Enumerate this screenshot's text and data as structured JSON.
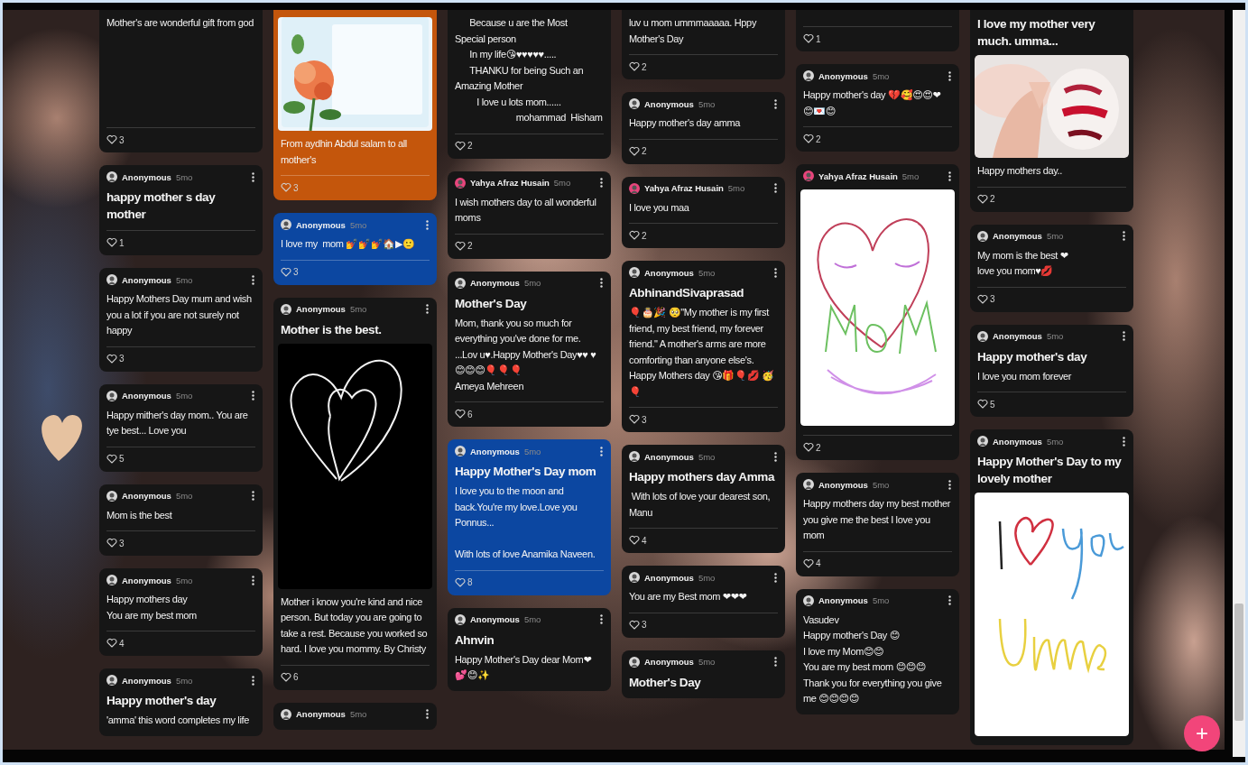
{
  "columns": [
    {
      "cards": [
        {
          "color": "#161616",
          "body": "Mother's are wonderful gift from god",
          "likes": "3"
        },
        {
          "color": "#161616",
          "author": "Anonymous",
          "time": "5mo",
          "avatar": {
            "color": "#d8d8d8"
          },
          "title": "happy mother s day mother",
          "likes": "1"
        },
        {
          "color": "#161616",
          "author": "Anonymous",
          "time": "5mo",
          "avatar": {
            "color": "#d8d8d8"
          },
          "body": "Happy Mothers Day mum and wish you a lot if you are not surely not happy",
          "likes": "3"
        },
        {
          "color": "#161616",
          "author": "Anonymous",
          "time": "5mo",
          "avatar": {
            "color": "#d8d8d8"
          },
          "body": "Happy mither's day mom.. You are tye best... Love you",
          "likes": "5"
        },
        {
          "color": "#161616",
          "author": "Anonymous",
          "time": "5mo",
          "avatar": {
            "color": "#d8d8d8"
          },
          "body": "Mom is the best",
          "likes": "3"
        },
        {
          "color": "#161616",
          "author": "Anonymous",
          "time": "5mo",
          "avatar": {
            "color": "#d8d8d8"
          },
          "body": "Happy mothers day\nYou are my best mom",
          "likes": "4"
        },
        {
          "color": "#161616",
          "author": "Anonymous",
          "time": "5mo",
          "avatar": {
            "color": "#d8d8d8"
          },
          "title": "Happy mother's day",
          "body": "'amma' this word completes my life"
        }
      ]
    },
    {
      "cards": [
        {
          "color": "#c4560c",
          "body": "From aydhin Abdul salam to all mother's",
          "likes": "3"
        },
        {
          "color": "#0c47a1",
          "author": "Anonymous",
          "time": "5mo",
          "avatar": {
            "color": "#d8d8d8"
          },
          "body": "I love my  mom 💅💅💅🏠▶🙂",
          "likes": "3"
        },
        {
          "color": "#161616",
          "author": "Anonymous",
          "time": "5mo",
          "avatar": {
            "color": "#d8d8d8"
          },
          "title": "Mother is the best.",
          "media": {
            "kind": "heart-sketch"
          },
          "body": "Mother i know you're kind and nice person. But today you are going to take a rest. Because you worked so hard. I love you mommy. By Christy",
          "likes": "6"
        },
        {
          "color": "#161616",
          "author": "Anonymous",
          "time": "5mo",
          "avatar": {
            "color": "#d8d8d8"
          }
        }
      ]
    },
    {
      "cards": [
        {
          "color": "#161616",
          "body": "      Because u are the Most\nSpecial person\n      In my life😘♥♥♥♥♥.....\n      THANKU for being Such an\nAmazing Mother\n         I love u lots mom......\n                         mohammad  Hisham",
          "likes": "2"
        },
        {
          "color": "#161616",
          "author": "Yahya Afraz Husain",
          "time": "5mo",
          "avatar": {
            "color": "#e8457c"
          },
          "body": "I wish mothers day to all wonderful moms",
          "likes": "2"
        },
        {
          "color": "#161616",
          "author": "Anonymous",
          "time": "5mo",
          "avatar": {
            "color": "#d8d8d8"
          },
          "title": "Mother's Day",
          "body": "Mom, thank you so much for everything you've done for me. ...Lov u♥.Happy Mother's Day♥♥ ♥😊😊😊🎈🎈🎈\nAmeya Mehreen",
          "likes": "6"
        },
        {
          "color": "#0c47a1",
          "author": "Anonymous",
          "time": "5mo",
          "avatar": {
            "color": "#d8d8d8"
          },
          "title": "Happy Mother's Day mom",
          "body": "I love you to the moon and back.You're my love.Love you Ponnus...\n\nWith lots of love Anamika Naveen.",
          "likes": "8"
        },
        {
          "color": "#161616",
          "author": "Anonymous",
          "time": "5mo",
          "avatar": {
            "color": "#d8d8d8"
          },
          "title": "Ahnvin",
          "body": "Happy Mother's Day dear Mom❤ 💕😊✨"
        }
      ]
    },
    {
      "cards": [
        {
          "color": "#161616",
          "body": "luv u mom ummmaaaaa. Hppy Mother's Day",
          "likes": "2"
        },
        {
          "color": "#161616",
          "author": "Anonymous",
          "time": "5mo",
          "avatar": {
            "color": "#d8d8d8"
          },
          "body": "Happy mother's day amma",
          "likes": "2"
        },
        {
          "color": "#161616",
          "author": "Yahya Afraz Husain",
          "time": "5mo",
          "avatar": {
            "color": "#e8457c"
          },
          "body": "I love you maa",
          "likes": "2"
        },
        {
          "color": "#161616",
          "author": "Anonymous",
          "time": "5mo",
          "avatar": {
            "color": "#d8d8d8"
          },
          "title": "AbhinandSivaprasad",
          "body": "🎈🎂🎉 🥺\"My mother is my first friend, my best friend, my forever friend.\" A mother's arms are more comforting than anyone else's. Happy Mothers day 😘🎁🎈💋 🥳🎈",
          "likes": "3"
        },
        {
          "color": "#161616",
          "author": "Anonymous",
          "time": "5mo",
          "avatar": {
            "color": "#d8d8d8"
          },
          "title": "Happy mothers day Amma",
          "body": " With lots of love your dearest son, Manu",
          "likes": "4"
        },
        {
          "color": "#161616",
          "author": "Anonymous",
          "time": "5mo",
          "avatar": {
            "color": "#d8d8d8"
          },
          "body": "You are my Best mom ❤❤❤",
          "likes": "3"
        },
        {
          "color": "#161616",
          "author": "Anonymous",
          "time": "5mo",
          "avatar": {
            "color": "#d8d8d8"
          },
          "title": "Mother's Day"
        }
      ]
    },
    {
      "cards": [
        {
          "color": "#161616",
          "likes": "1"
        },
        {
          "color": "#161616",
          "author": "Anonymous",
          "time": "5mo",
          "avatar": {
            "color": "#d8d8d8"
          },
          "body": "Happy mother's day 💔🥰😍😍❤ 😊💌😊",
          "likes": "2"
        },
        {
          "color": "#161616",
          "author": "Yahya Afraz Husain",
          "time": "5mo",
          "avatar": {
            "color": "#e8457c"
          },
          "media": {
            "kind": "face-sketch"
          },
          "likes": "2"
        },
        {
          "color": "#161616",
          "author": "Anonymous",
          "time": "5mo",
          "avatar": {
            "color": "#d8d8d8"
          },
          "body": "Happy mothers day my best mother you give me the best I love you mom",
          "likes": "4"
        },
        {
          "color": "#161616",
          "author": "Anonymous",
          "time": "5mo",
          "avatar": {
            "color": "#d8d8d8"
          },
          "body": "Vasudev\nHappy mother's Day 😊\nI love my Mom😊😊\nYou are my best mom 😊😊😊\nThank you for everything you give me 😊😊😊😊"
        }
      ]
    },
    {
      "cards": [
        {
          "color": "#161616",
          "title": "I love my mother very much. umma...",
          "body": "Happy mothers day..",
          "likes": "2"
        },
        {
          "color": "#161616",
          "author": "Anonymous",
          "time": "5mo",
          "avatar": {
            "color": "#d8d8d8"
          },
          "body": "My mom is the best ❤\nlove you mom♥💋",
          "likes": "3"
        },
        {
          "color": "#161616",
          "author": "Anonymous",
          "time": "5mo",
          "avatar": {
            "color": "#d8d8d8"
          },
          "title": "Happy mother's day",
          "body": "I love you mom forever",
          "likes": "5"
        },
        {
          "color": "#161616",
          "author": "Anonymous",
          "time": "5mo",
          "avatar": {
            "color": "#d8d8d8"
          },
          "title": "Happy Mother's Day to my lovely mother",
          "media": {
            "kind": "word-sketch"
          }
        }
      ]
    }
  ],
  "add_button": {
    "label": "+"
  }
}
